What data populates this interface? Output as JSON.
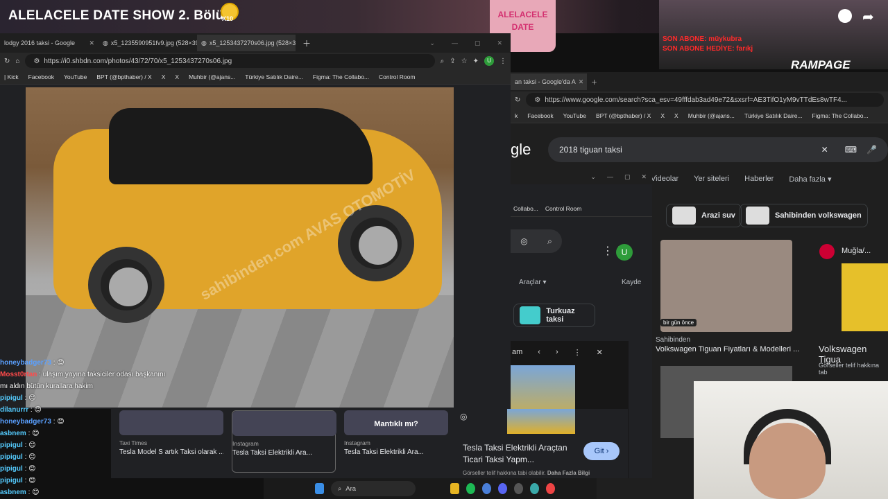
{
  "stream": {
    "title": "ALELACELE DATE SHOW 2. Bölüm",
    "emoji_badge": "X10",
    "sign_text": "ALELACELE DATE",
    "sub_line1": "SON ABONE: müykubra",
    "sub_line2": "SON ABONE HEDİYE: farıkj",
    "brand": "RAMPAGE"
  },
  "win1": {
    "tabs": [
      {
        "label": "lodgy 2016 taksi - Google"
      },
      {
        "label": "x5_1235590951fv9.jpg (528×39"
      },
      {
        "label": "x5_1253437270s06.jpg (528×39"
      }
    ],
    "url": "https://i0.shbdn.com/photos/43/72/70/x5_1253437270s06.jpg",
    "bookmarks": [
      "| Kick",
      "Facebook",
      "YouTube",
      "BPT (@bpthaber) / X",
      "X",
      "X",
      "Muhbir (@ajans...",
      "Türkiye Satılık Daire...",
      "Figma: The Collabo...",
      "Control Room"
    ],
    "watermark": "sahibinden.com  AVAS OTOMOTİV"
  },
  "win2": {
    "tab_label": "an taksi - Google'da A",
    "url": "https://www.google.com/search?sca_esv=49fffdab3ad49e72&sxsrf=AE3TifO1yM9vTTdEs8wTF4...",
    "bookmarks": [
      "k",
      "Facebook",
      "YouTube",
      "BPT (@bpthaber) / X",
      "X",
      "X",
      "Muhbir (@ajans...",
      "Türkiye Satılık Daire...",
      "Figma: The Collabo..."
    ],
    "logo": "gle",
    "search_query": "2018 tiguan taksi",
    "nav_tabs": [
      "Videolar",
      "Yer siteleri",
      "Haberler",
      "Daha fazla ▾"
    ],
    "chips": [
      "Arazi suv",
      "Sahibinden volkswagen"
    ],
    "result1": {
      "badge": "bir gün önce",
      "source": "Sahibinden",
      "title": "Volkswagen Tiguan Fiyatları & Modelleri ..."
    },
    "result2": {
      "source": "Muğla/...",
      "title": "Volkswagen Tigua",
      "note": "Görseller telif hakkına tab"
    }
  },
  "win3": {
    "bookmarks": [
      "Collabo...",
      "Control Room"
    ],
    "menu": "Araçlar ▾",
    "saved": "Kayde",
    "chip": "Turkuaz taksi",
    "panel_label": "am",
    "result_title": "Tesla Taksi Elektrikli Araçtan Ticari Taksi Yapm...",
    "git_label": "Git ›",
    "note": "Görseller telif hakkına tabi olabilir.",
    "more": "Daha Fazla Bilgi"
  },
  "strip": {
    "cards": [
      {
        "source": "Taxi Times",
        "title": "Tesla Model S artık Taksi olarak ..."
      },
      {
        "source": "Instagram",
        "title": "Tesla Taksi Elektrikli Ara..."
      },
      {
        "source": "Instagram",
        "title": "Tesla Taksi Elektrikli Ara...",
        "overlay": "Mantıklı mı?"
      }
    ]
  },
  "chat": [
    {
      "user": "honeybadger73",
      "text": ": 😊",
      "color": "blue"
    },
    {
      "user": "Mosst0rtan",
      "text": ": ulaşım yayına taksiciler odası başkanını",
      "color": "red"
    },
    {
      "user": "",
      "text": "mı aldın bütün kurallara hakim",
      "color": "red"
    },
    {
      "user": "pipigul",
      "text": ": 😊",
      "color": "cyan"
    },
    {
      "user": "dilanurrr",
      "text": ": 😊",
      "color": "cyan"
    },
    {
      "user": "honeybadger73",
      "text": ": 😊",
      "color": "blue"
    },
    {
      "user": "asbnem",
      "text": ": 😊",
      "color": "cyan"
    },
    {
      "user": "pipigul",
      "text": ": 😊",
      "color": "cyan"
    },
    {
      "user": "pipigul",
      "text": ": 😊",
      "color": "cyan"
    },
    {
      "user": "pipigul",
      "text": ": 😊",
      "color": "cyan"
    },
    {
      "user": "pipigul",
      "text": ": 😊",
      "color": "cyan"
    },
    {
      "user": "asbnem",
      "text": ": 😊",
      "color": "cyan"
    }
  ],
  "taskbar": {
    "search_label": "Ara"
  },
  "colors": {
    "accent_yellow": "#e0a42a",
    "google_bg": "#202124",
    "chat_red": "#ff4a4a"
  }
}
